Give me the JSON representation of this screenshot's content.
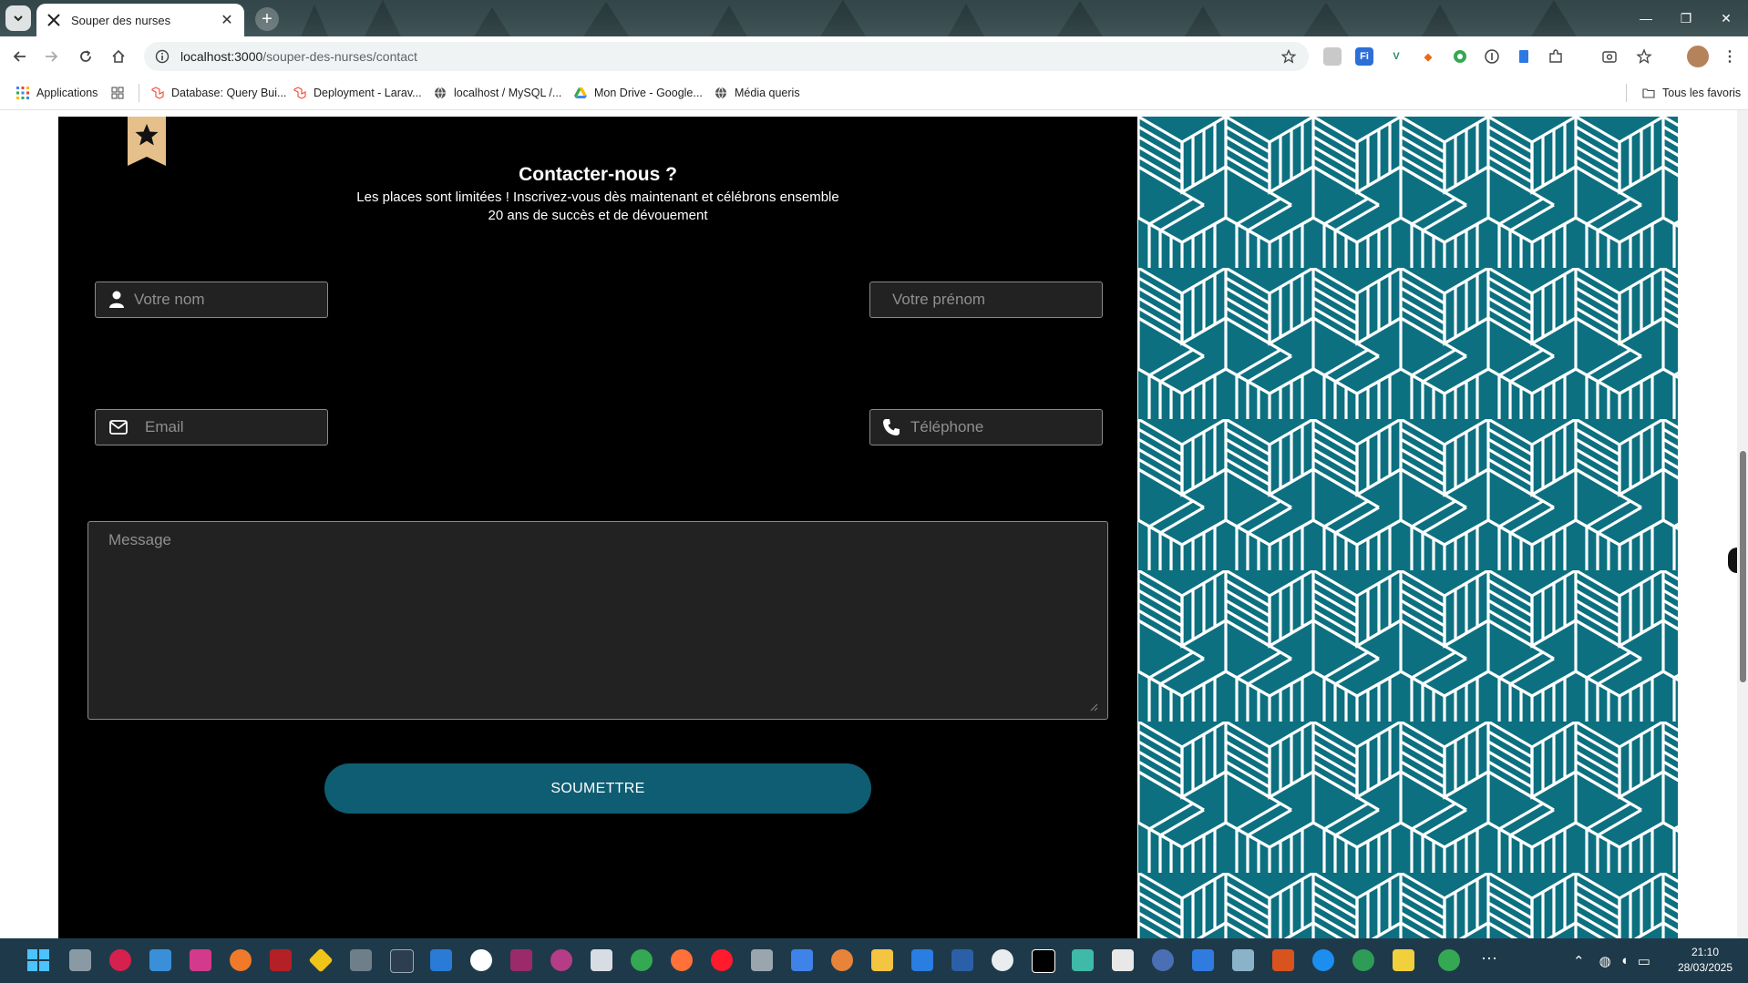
{
  "browser": {
    "tab_title": "Souper des nurses",
    "url_host": "localhost:3000",
    "url_path": "/souper-des-nurses/contact",
    "bookmarks": [
      {
        "label": "Applications",
        "icon": "apps-grid-icon"
      },
      {
        "label": "Database: Query Bui...",
        "icon": "laravel-icon"
      },
      {
        "label": "Deployment - Larav...",
        "icon": "laravel-icon"
      },
      {
        "label": "localhost / MySQL /...",
        "icon": "globe-icon"
      },
      {
        "label": "Mon Drive - Google...",
        "icon": "google-drive-icon"
      },
      {
        "label": "Média queris",
        "icon": "globe-icon"
      }
    ],
    "all_bookmarks_label": "Tous les favoris"
  },
  "contact": {
    "title": "Contacter-nous ?",
    "subtitle_line1": "Les places sont limitées ! Inscrivez-vous dès maintenant et célébrons ensemble",
    "subtitle_line2": "20 ans de succès et de dévouement",
    "fields": {
      "name_placeholder": "Votre nom",
      "firstname_placeholder": "Votre prénom",
      "email_placeholder": "Email",
      "phone_placeholder": "Téléphone",
      "message_placeholder": "Message"
    },
    "submit_label": "SOUMETTRE"
  },
  "colors": {
    "panel_bg": "#000000",
    "field_bg": "#222222",
    "submit_bg": "#0e5d72",
    "pattern_bg": "#0d7080",
    "ribbon": "#e6c08a"
  },
  "taskbar": {
    "time": "21:10",
    "date": "28/03/2025"
  }
}
